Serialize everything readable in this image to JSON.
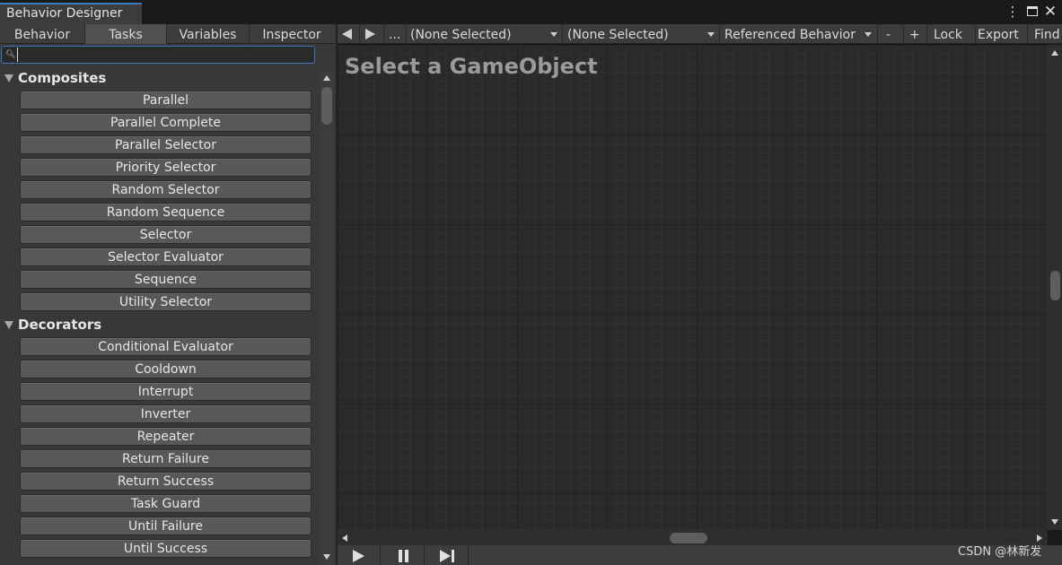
{
  "window": {
    "title": "Behavior Designer",
    "accent": "#3a79bb"
  },
  "left_tabs": [
    {
      "label": "Behavior",
      "active": false
    },
    {
      "label": "Tasks",
      "active": true
    },
    {
      "label": "Variables",
      "active": false
    },
    {
      "label": "Inspector",
      "active": false
    }
  ],
  "search": {
    "value": "",
    "placeholder": ""
  },
  "categories": [
    {
      "label": "Composites",
      "tasks": [
        "Parallel",
        "Parallel Complete",
        "Parallel Selector",
        "Priority Selector",
        "Random Selector",
        "Random Sequence",
        "Selector",
        "Selector Evaluator",
        "Sequence",
        "Utility Selector"
      ]
    },
    {
      "label": "Decorators",
      "tasks": [
        "Conditional Evaluator",
        "Cooldown",
        "Interrupt",
        "Inverter",
        "Repeater",
        "Return Failure",
        "Return Success",
        "Task Guard",
        "Until Failure",
        "Until Success"
      ]
    }
  ],
  "toolbar": {
    "more_label": "...",
    "dropdown1": "(None Selected)",
    "dropdown2": "(None Selected)",
    "referenced_behavior": "Referenced Behavior",
    "minus": "-",
    "plus": "+",
    "lock": "Lock",
    "export": "Export",
    "find": "Find"
  },
  "graph": {
    "message": "Select a GameObject"
  },
  "watermark": "CSDN @林新发"
}
